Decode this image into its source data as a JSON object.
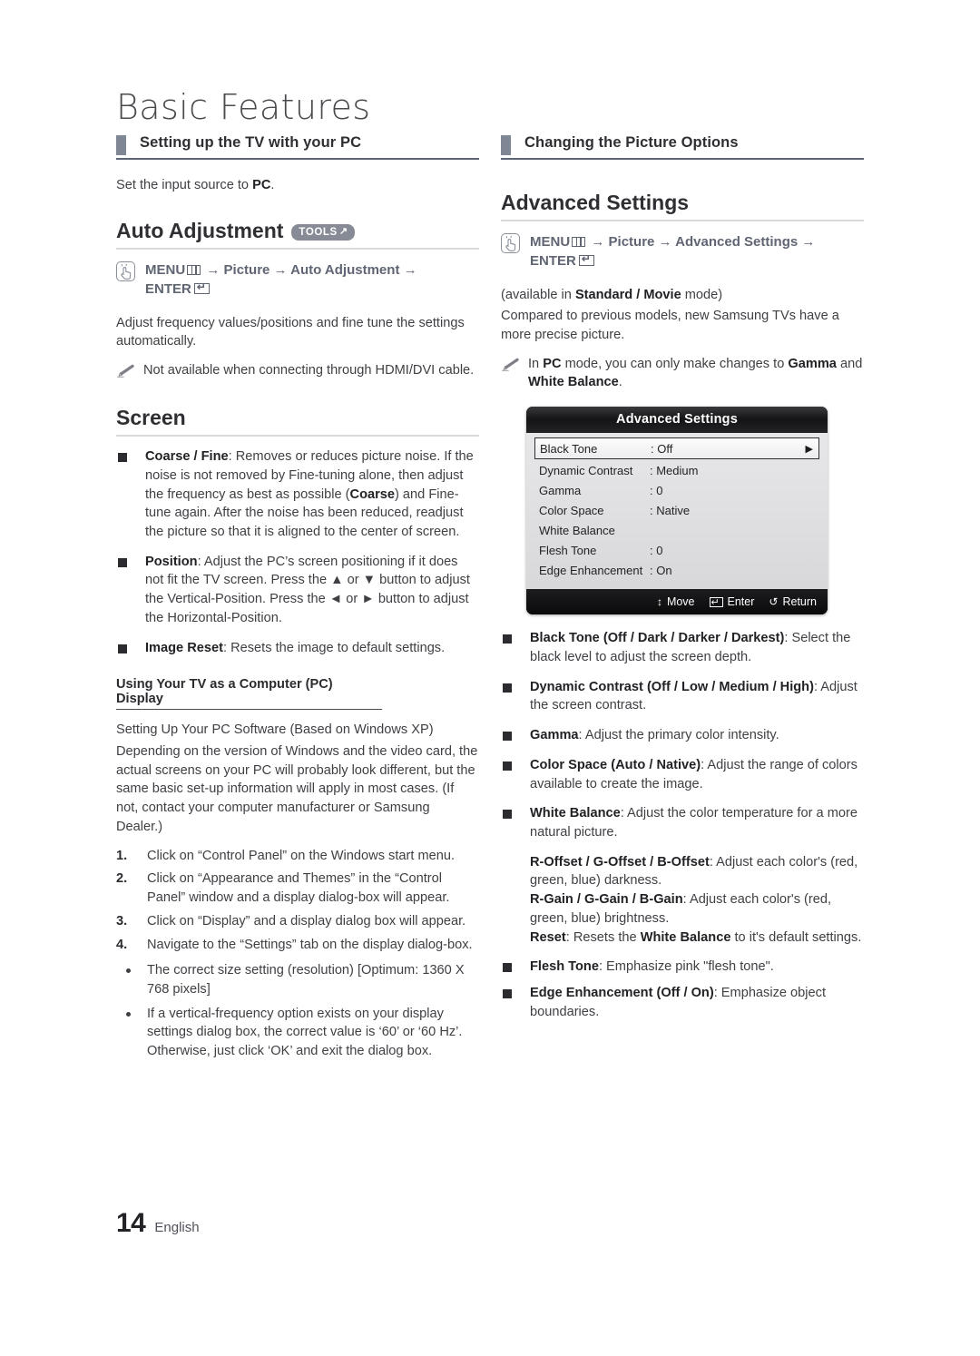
{
  "page": {
    "title": "Basic Features",
    "footer_page_number": "14",
    "footer_language": "English"
  },
  "left_column": {
    "section_header": "Setting up the TV with your PC",
    "intro": {
      "prefix": "Set the input source to ",
      "bold": "PC",
      "suffix": "."
    },
    "auto_adjustment": {
      "heading": "Auto Adjustment",
      "tools_badge": "TOOLS",
      "tools_badge_glyph": "↗",
      "menu_path": {
        "menu_label": "MENU",
        "arrow": "→",
        "step1": "Picture",
        "step2": "Auto Adjustment",
        "enter_label": "ENTER"
      },
      "description": "Adjust frequency values/positions and fine tune the settings automatically.",
      "note": "Not available when connecting through HDMI/DVI cable."
    },
    "screen": {
      "heading": "Screen",
      "items": [
        {
          "bold": "Coarse / Fine",
          "text": ": Removes or reduces picture noise. If the noise is not removed by Fine-tuning alone, then adjust the frequency as best as possible (Coarse) and Fine-tune again. After the noise has been reduced, readjust the picture so that it is aligned to the center of screen.",
          "bold_inline": "Coarse"
        },
        {
          "bold": "Position",
          "text": ": Adjust the PC’s screen positioning if it does not fit the TV screen. Press the ▲ or ▼ button to adjust the Vertical-Position. Press the ◄ or ► button to adjust the Horizontal-Position."
        },
        {
          "bold": "Image Reset",
          "text": ": Resets the image to default settings."
        }
      ]
    },
    "pc_display": {
      "subheading": "Using Your TV as a Computer (PC) Display",
      "para1": "Setting Up Your PC Software (Based on Windows XP)",
      "para2": "Depending on the version of Windows and the video card, the actual screens on your PC will probably look different, but the same basic set-up information will apply in most cases. (If not, contact your computer manufacturer or Samsung Dealer.)",
      "steps": [
        {
          "n": "1.",
          "text": "Click on “Control Panel” on the Windows start menu."
        },
        {
          "n": "2.",
          "text": "Click on “Appearance and Themes” in the “Control Panel” window and a display dialog-box will appear."
        },
        {
          "n": "3.",
          "text": "Click on “Display” and a display dialog box will appear."
        },
        {
          "n": "4.",
          "text": "Navigate to the “Settings” tab on the display dialog-box."
        }
      ],
      "bullets": [
        "The correct size setting (resolution) [Optimum: 1360 X 768 pixels]",
        "If a vertical-frequency option exists on your display settings dialog box, the correct value is ‘60’ or ‘60 Hz’. Otherwise, just click ‘OK’ and exit the dialog box."
      ]
    }
  },
  "right_column": {
    "section_header": "Changing the Picture Options",
    "advanced_settings": {
      "heading": "Advanced Settings",
      "menu_path": {
        "menu_label": "MENU",
        "arrow": "→",
        "step1": "Picture",
        "step2": "Advanced Settings",
        "enter_label": "ENTER"
      },
      "availability_prefix": "(available in ",
      "availability_bold": "Standard / Movie",
      "availability_suffix": " mode)",
      "description": "Compared to previous models, new Samsung TVs have a more precise picture.",
      "note": "In PC mode, you can only make changes to Gamma and White Balance."
    },
    "osd": {
      "title": "Advanced Settings",
      "rows": [
        {
          "label": "Black Tone",
          "value": ": Off",
          "selected": true,
          "arrow": "▶"
        },
        {
          "label": "Dynamic Contrast",
          "value": ": Medium",
          "selected": false,
          "arrow": ""
        },
        {
          "label": "Gamma",
          "value": ": 0",
          "selected": false,
          "arrow": ""
        },
        {
          "label": "Color Space",
          "value": ": Native",
          "selected": false,
          "arrow": ""
        },
        {
          "label": "White Balance",
          "value": "",
          "selected": false,
          "arrow": ""
        },
        {
          "label": "Flesh Tone",
          "value": ": 0",
          "selected": false,
          "arrow": ""
        },
        {
          "label": "Edge Enhancement",
          "value": ": On",
          "selected": false,
          "arrow": ""
        }
      ],
      "footer": {
        "move_glyph": "↕",
        "move_label": "Move",
        "enter_label": "Enter",
        "return_glyph": "↺",
        "return_label": "Return"
      }
    },
    "options": [
      {
        "bold": "Black Tone (Off / Dark / Darker / Darkest)",
        "text": ": Select the black level to adjust the screen depth."
      },
      {
        "bold": "Dynamic Contrast (Off / Low / Medium / High)",
        "text": ": Adjust the screen contrast."
      },
      {
        "bold": "Gamma",
        "text": ": Adjust the primary color intensity."
      },
      {
        "bold": "Color Space (Auto / Native)",
        "text": ": Adjust the range of colors available to create the image."
      },
      {
        "bold": "White Balance",
        "text": ": Adjust the color temperature for a more natural picture."
      },
      {
        "bold": "Flesh Tone",
        "text": ": Emphasize pink \"flesh tone\"."
      },
      {
        "bold": "Edge Enhancement (Off / On)",
        "text": ": Emphasize object boundaries."
      }
    ],
    "white_balance_sub": [
      {
        "bold": "R-Offset / G-Offset / B-Offset",
        "text": ": Adjust each color's (red, green, blue) darkness."
      },
      {
        "bold": "R-Gain / G-Gain / B-Gain",
        "text": ": Adjust each color's (red, green, blue) brightness."
      },
      {
        "bold": "Reset",
        "text": ": Resets the White Balance to it's default settings."
      }
    ]
  },
  "colors": {
    "marker": "#7f8694",
    "rule": "#5d6473",
    "menu_path_text": "#5f6473",
    "tools_badge_bg": "#878b96",
    "bullet": "#2c2c30"
  }
}
